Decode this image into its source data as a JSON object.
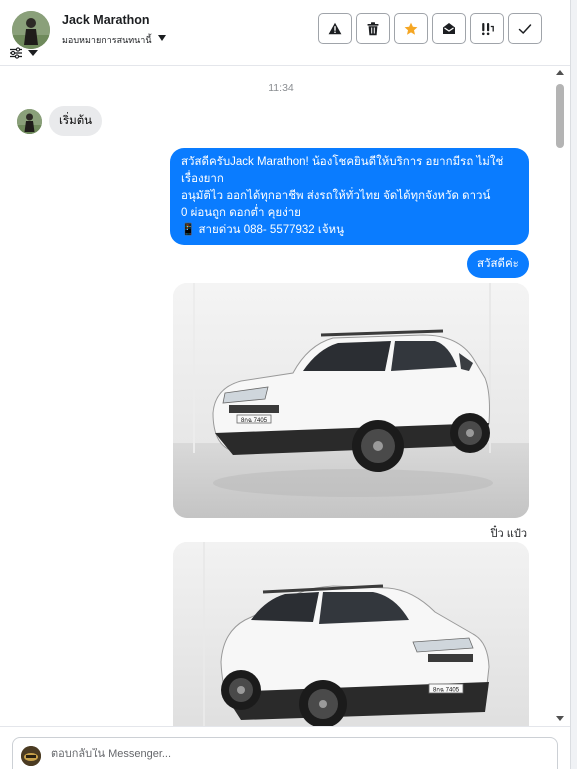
{
  "header": {
    "contact_name": "Jack Marathon",
    "assign_label": "มอบหมายการสนทนานี้"
  },
  "actions": [
    {
      "name": "warning-icon"
    },
    {
      "name": "trash-icon"
    },
    {
      "name": "star-icon",
      "color": "#f5a623"
    },
    {
      "name": "mark-unread-icon"
    },
    {
      "name": "priority-icon"
    },
    {
      "name": "check-icon"
    }
  ],
  "conversation": {
    "timestamp": "11:34",
    "incoming_message": "เริ่มต้น",
    "outgoing_message_lines": [
      "สวัสดีครับJack Marathon! น้องโชคยินดีให้บริการ อยากมีรถ ไม่ใช่",
      "เรื่องยาก",
      "อนุมัติไว ออกได้ทุกอาชีพ ส่งรถให้ทั่วไทย จัดได้ทุกจังหวัด ดาวน์",
      "0  ผ่อนถูก ดอกต่ำ คุยง่าย",
      "📱 สายด่วน 088- 5577932 เจ้หนู"
    ],
    "outgoing_reply": "สวัสดีค่ะ",
    "plate_1": "8กฉ 7405",
    "plate_2": "8กฉ 7405",
    "read_by": "ปิ๋ว แป๋ว"
  },
  "composer": {
    "placeholder": "ตอบกลับใน Messenger..."
  },
  "colors": {
    "outgoing_bubble": "#0a7cff",
    "incoming_bubble": "#e9eaec",
    "star_accent": "#f5a623"
  }
}
